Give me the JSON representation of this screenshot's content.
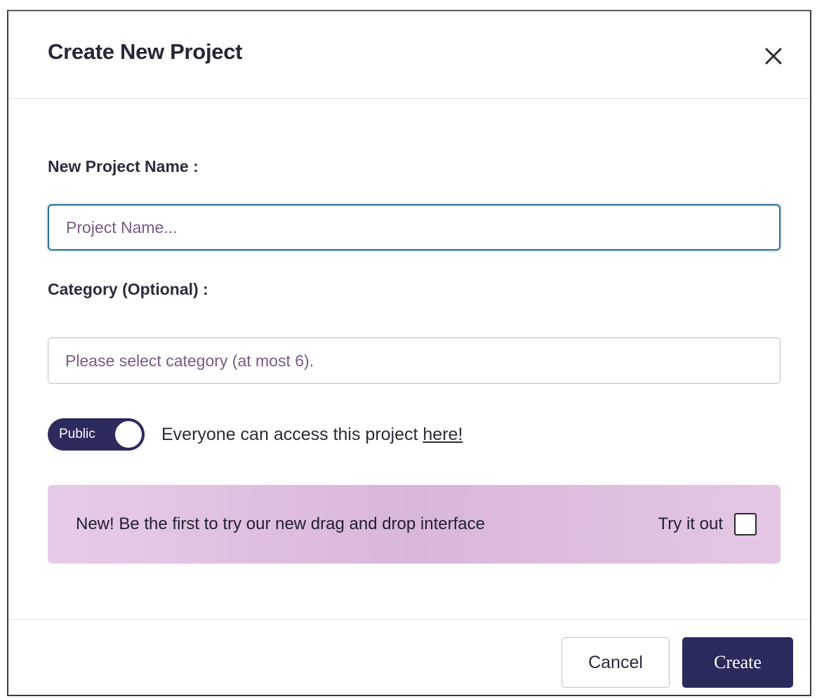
{
  "dialog": {
    "title": "Create New Project",
    "close_icon": "close-icon"
  },
  "form": {
    "name_label": "New Project Name :",
    "name_placeholder": "Project Name...",
    "name_value": "",
    "category_label": "Category (Optional) :",
    "category_placeholder": "Please select category (at most 6)."
  },
  "visibility": {
    "toggle_label": "Public",
    "toggle_on": true,
    "description": "Everyone can access this project ",
    "link_text": "here!"
  },
  "promo": {
    "message": "New! Be the first to try our new drag and drop interface",
    "try_label": "Try it out",
    "checked": false
  },
  "footer": {
    "cancel_label": "Cancel",
    "create_label": "Create"
  },
  "colors": {
    "primary": "#2b2a5c",
    "input_focus_border": "#2a6f9a",
    "promo_background": "#dcbadf",
    "placeholder_text": "#7a5a86"
  }
}
